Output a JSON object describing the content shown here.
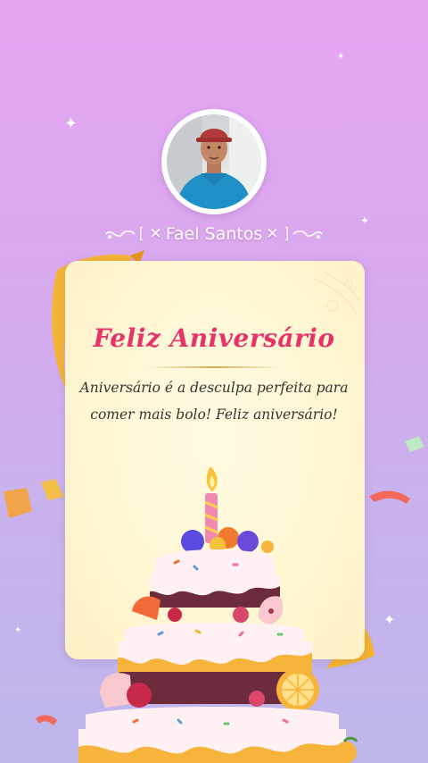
{
  "profile": {
    "name": "Fael Santos",
    "name_prefix": "[ ✕",
    "name_suffix": "✕ ]"
  },
  "card": {
    "title": "Feliz Aniversário",
    "message_line1": "Aniversário é a desculpa perfeita para",
    "message_line2": "comer mais bolo! Feliz aniversário!"
  },
  "icons": [
    "sparkle-icon",
    "ribbon-icon",
    "confetti-icon",
    "cake-icon",
    "candle-icon",
    "avatar"
  ],
  "colors": {
    "title": "#e8336a",
    "background_top": "#e7a6f2",
    "background_bottom": "#bfb7ea",
    "card": "#fff6d3",
    "ribbon": "#f6b42c"
  }
}
